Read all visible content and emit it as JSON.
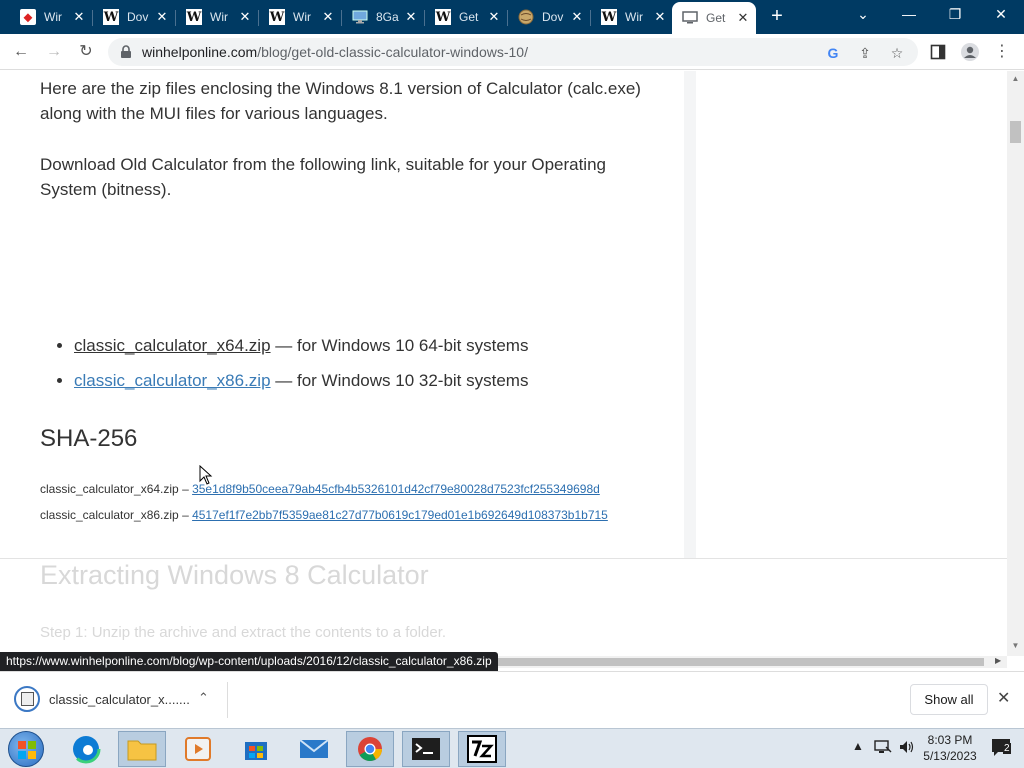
{
  "tabs": [
    {
      "icon": "redsite-icon",
      "title": "Wir"
    },
    {
      "icon": "w-icon",
      "title": "Dov"
    },
    {
      "icon": "w-icon",
      "title": "Wir"
    },
    {
      "icon": "w-icon",
      "title": "Wir"
    },
    {
      "icon": "monitor-icon",
      "title": "8Ga"
    },
    {
      "icon": "w-icon",
      "title": "Get"
    },
    {
      "icon": "globe-icon",
      "title": "Dov"
    },
    {
      "icon": "w-icon",
      "title": "Wir"
    },
    {
      "icon": "page-icon",
      "title": "Get",
      "active": true
    }
  ],
  "omnibox": {
    "domain": "winhelponline.com",
    "path": "/blog/get-old-classic-calculator-windows-10/"
  },
  "article": {
    "para1": "Here are the zip files enclosing the Windows 8.1 version of Calculator (calc.exe) along with the MUI files for various languages.",
    "para2": "Download Old Calculator from the following link, suitable for your Operating System (bitness).",
    "downloads": [
      {
        "link": "classic_calculator_x64.zip",
        "desc": " — for Windows 10 64-bit systems"
      },
      {
        "link": "classic_calculator_x86.zip",
        "desc": " — for Windows 10 32-bit systems"
      }
    ],
    "sha_heading": "SHA-256",
    "hashes": [
      {
        "file": "classic_calculator_x64.zip – ",
        "hash": "35e1d8f9b50ceea79ab45cfb4b5326101d42cf79e80028d7523fcf255349698d"
      },
      {
        "file": "classic_calculator_x86.zip – ",
        "hash": "4517ef1f7e2bb7f5359ae81c27d77b0619c179ed01e1b692649d108373b1b715"
      }
    ],
    "next_heading": "Extracting Windows 8 Calculator",
    "next_step": "Step 1: Unzip the archive and extract the contents to a folder."
  },
  "status_url": "https://www.winhelponline.com/blog/wp-content/uploads/2016/12/classic_calculator_x86.zip",
  "download_bar": {
    "item_name": "classic_calculator_x.......",
    "show_all": "Show all"
  },
  "taskbar": {
    "time": "8:03 PM",
    "date": "5/13/2023",
    "notifications": "2"
  }
}
